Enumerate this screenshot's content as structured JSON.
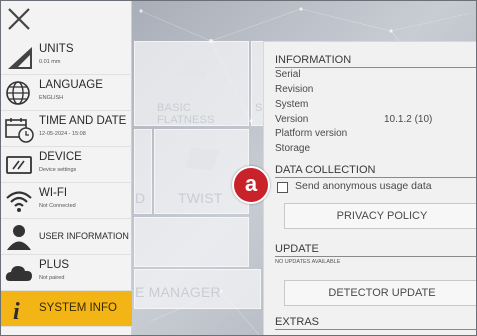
{
  "sidebar": {
    "close_icon": "close-icon",
    "items": [
      {
        "label": "UNITS",
        "sub": "0.01 mm",
        "icon": "ruler-triangle-icon"
      },
      {
        "label": "LANGUAGE",
        "sub": "ENGLISH",
        "icon": "globe-icon"
      },
      {
        "label": "TIME AND DATE",
        "sub": "12-05-2024 - 15:08",
        "icon": "calendar-clock-icon"
      },
      {
        "label": "DEVICE",
        "sub": "Device settings",
        "icon": "device-icon"
      },
      {
        "label": "WI-FI",
        "sub": "Not Connected",
        "icon": "wifi-icon"
      },
      {
        "label": "USER INFORMATION",
        "sub": "",
        "icon": "user-icon"
      },
      {
        "label": "PLUS",
        "sub": "Not paired",
        "icon": "cloud-icon"
      },
      {
        "label": "SYSTEM INFO",
        "sub": "",
        "icon": "info-icon"
      }
    ],
    "active_color": "#f2b515"
  },
  "background_tiles": {
    "basic_flatness": "BASIC FLATNESS",
    "twist": "TWIST",
    "manager": "E MANAGER",
    "partial_s": "S",
    "partial_d": "D"
  },
  "panel": {
    "information": {
      "title": "INFORMATION",
      "rows": [
        {
          "label": "Serial",
          "value": ""
        },
        {
          "label": "Revision",
          "value": ""
        },
        {
          "label": "System",
          "value": ""
        },
        {
          "label": "Version",
          "value": "10.1.2 (10)"
        },
        {
          "label": "Platform version",
          "value": ""
        },
        {
          "label": "Storage",
          "value": ""
        }
      ]
    },
    "data_collection": {
      "title": "DATA COLLECTION",
      "checkbox_label": "Send anonymous usage data",
      "checked": false,
      "privacy_button": "PRIVACY POLICY"
    },
    "update": {
      "title": "UPDATE",
      "status": "NO UPDATES AVAILABLE",
      "detector_button": "DETECTOR UPDATE"
    },
    "extras": {
      "title": "EXTRAS"
    }
  },
  "annotation": {
    "marker": "a",
    "color": "#c8222b"
  }
}
